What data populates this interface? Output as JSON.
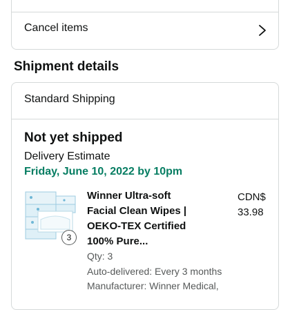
{
  "order": {
    "cancel_label": "Cancel items"
  },
  "shipment": {
    "section_title": "Shipment details",
    "method": "Standard Shipping",
    "status": "Not yet shipped",
    "estimate_label": "Delivery Estimate",
    "estimate_date": "Friday, June 10, 2022 by 10pm"
  },
  "item": {
    "title_line1": "Winner Ultra-soft",
    "title_line2": "Facial Clean Wipes |",
    "title_line3": "OEKO-TEX Certified",
    "title_line4": "100% Pure...",
    "price_currency": "CDN$",
    "price_amount": "33.98",
    "quantity_badge": "3",
    "qty": "Qty: 3",
    "auto_delivery": "Auto-delivered: Every 3 months",
    "manufacturer": "Manufacturer: Winner Medical,"
  },
  "colors": {
    "accent_green": "#067d62",
    "border": "#d5d9d9",
    "secondary_text": "#565959"
  },
  "icons": {
    "chevron": "chevron-right-icon",
    "product_image": "product-image"
  }
}
